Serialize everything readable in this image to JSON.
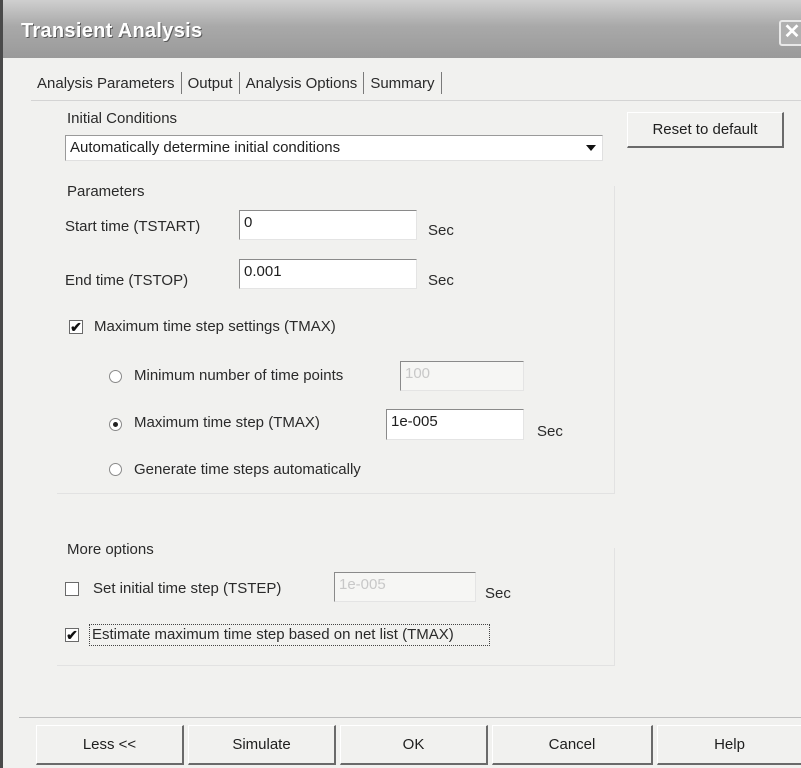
{
  "window": {
    "title": "Transient Analysis",
    "close_symbol": "✕"
  },
  "tabs": [
    {
      "label": "Analysis Parameters",
      "active": true
    },
    {
      "label": "Output",
      "active": false
    },
    {
      "label": "Analysis Options",
      "active": false
    },
    {
      "label": "Summary",
      "active": false
    }
  ],
  "initial_conditions": {
    "group_label": "Initial Conditions",
    "selected": "Automatically determine initial conditions",
    "reset_label": "Reset to default"
  },
  "parameters": {
    "group_label": "Parameters",
    "start_time": {
      "label": "Start time (TSTART)",
      "value": "0",
      "unit": "Sec"
    },
    "end_time": {
      "label": "End time (TSTOP)",
      "value": "0.001",
      "unit": "Sec"
    },
    "max_step_settings": {
      "label": "Maximum time step settings (TMAX)",
      "checked": true
    },
    "min_points": {
      "label": "Minimum number of time points",
      "value": "100",
      "selected": false
    },
    "max_step": {
      "label": "Maximum time step (TMAX)",
      "value": "1e-005",
      "unit": "Sec",
      "selected": true
    },
    "auto_steps": {
      "label": "Generate time steps automatically",
      "selected": false
    }
  },
  "more_options": {
    "group_label": "More options",
    "initial_step": {
      "label": "Set initial time step (TSTEP)",
      "value": "1e-005",
      "unit": "Sec",
      "checked": false
    },
    "estimate_step": {
      "label": "Estimate maximum time step based on net list (TMAX)",
      "checked": true
    }
  },
  "buttons": {
    "less": "Less <<",
    "simulate": "Simulate",
    "ok": "OK",
    "cancel": "Cancel",
    "help": "Help"
  },
  "icons": {
    "check": "✔"
  }
}
